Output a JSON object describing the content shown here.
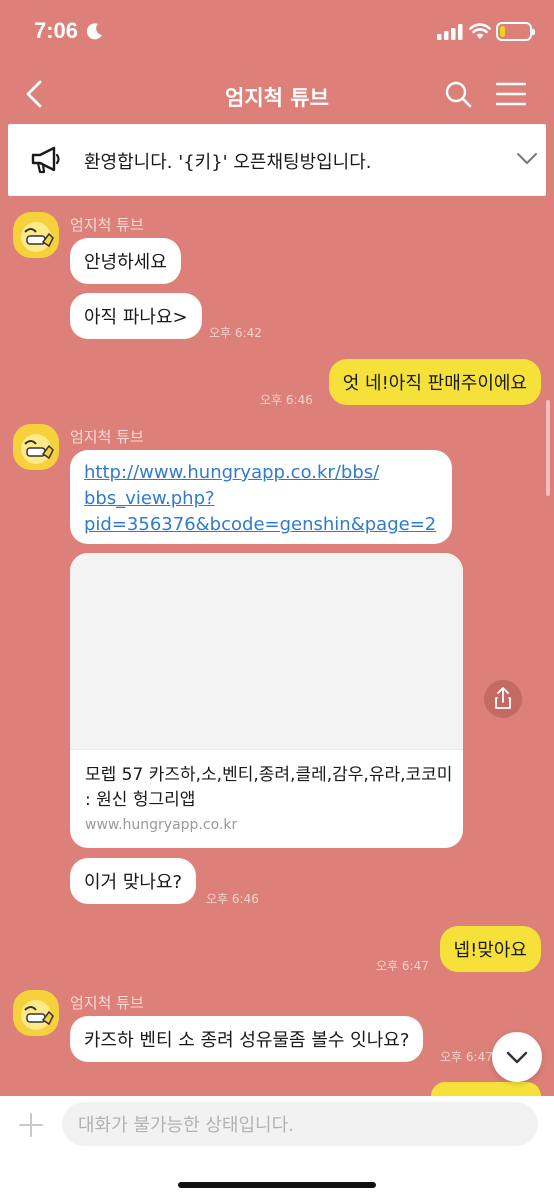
{
  "status_bar": {
    "time": "7:06",
    "battery_level": 0.18,
    "battery_color": "#f2d11f"
  },
  "header": {
    "title": "엄지척 튜브"
  },
  "notice": {
    "text": "환영합니다. '{키}' 오픈채팅방입니다."
  },
  "messages": {
    "sender1": "엄지척 튜브",
    "m1": "안녕하세요",
    "m2": "아직 파나요>",
    "t2": "오후 6:42",
    "m3": "엇 네!아직 판매주이에요",
    "t3": "오후 6:46",
    "sender2": "엄지척 튜브",
    "link_line1": "http://www.hungryapp.co.kr/bbs/",
    "link_line2": "bbs_view.php?",
    "link_line3": "pid=356376&bcode=genshin&page=2",
    "preview_title": "모렙 57 카즈하,소,벤티,종려,클레,감우,유라,코코미 : 원신 헝그리앱",
    "preview_domain": "www.hungryapp.co.kr",
    "m4": "이거 맞나요?",
    "t4": "오후 6:46",
    "m5": "넵!맞아요",
    "t5": "오후 6:47",
    "sender3": "엄지척 튜브",
    "m6": "카즈하 벤티 소 종려 성유물좀 볼수 잇나요?",
    "t6": "오후 6:47"
  },
  "input": {
    "placeholder": "대화가 불가능한 상태입니다."
  },
  "colors": {
    "background": "#dc8079",
    "my_bubble": "#f6e13a",
    "link": "#2f7bd0"
  }
}
